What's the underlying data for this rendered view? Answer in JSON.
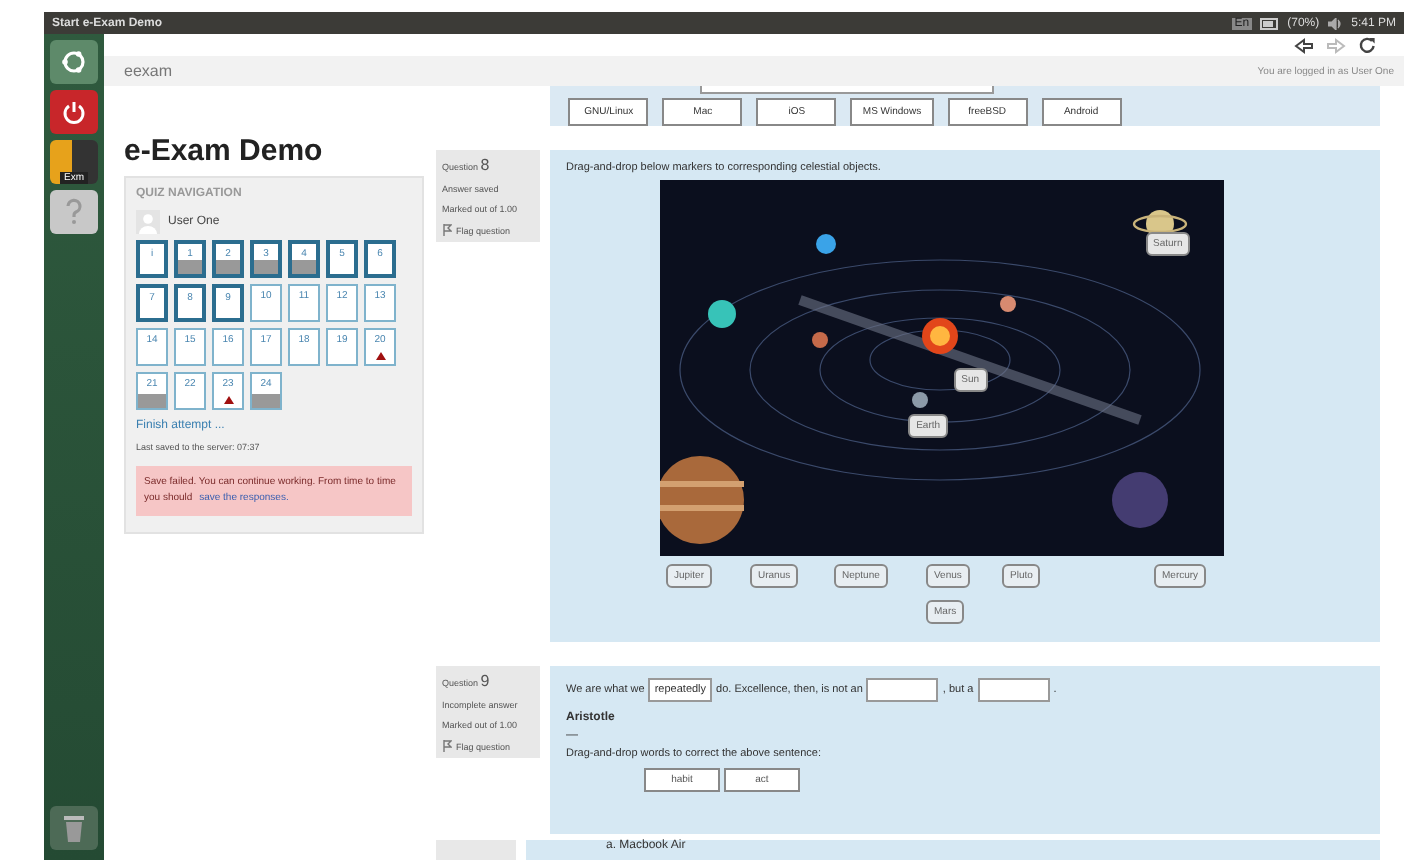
{
  "top_panel": {
    "title": "Start e-Exam Demo",
    "keyboard": "En",
    "battery": "(70%)",
    "time": "5:41 PM"
  },
  "launcher": {
    "exam_label": "Exm"
  },
  "header": {
    "site": "eexam",
    "login": "You are logged in as User One"
  },
  "page_title": "e-Exam Demo",
  "previous_question": {
    "options": [
      "GNU/Linux",
      "Mac",
      "iOS",
      "MS Windows",
      "freeBSD",
      "Android"
    ]
  },
  "quiz_navigation": {
    "heading": "QUIZ NAVIGATION",
    "user": "User One",
    "buttons": [
      {
        "label": "i",
        "current": true,
        "answered": false,
        "flagged": false
      },
      {
        "label": "1",
        "current": true,
        "answered": true,
        "flagged": false
      },
      {
        "label": "2",
        "current": true,
        "answered": true,
        "flagged": false
      },
      {
        "label": "3",
        "current": true,
        "answered": true,
        "flagged": false
      },
      {
        "label": "4",
        "current": true,
        "answered": true,
        "flagged": false
      },
      {
        "label": "5",
        "current": true,
        "answered": false,
        "flagged": false
      },
      {
        "label": "6",
        "current": true,
        "answered": false,
        "flagged": false
      },
      {
        "label": "7",
        "current": true,
        "answered": false,
        "flagged": false
      },
      {
        "label": "8",
        "current": true,
        "answered": false,
        "flagged": false
      },
      {
        "label": "9",
        "current": true,
        "answered": false,
        "flagged": false
      },
      {
        "label": "10",
        "current": false,
        "answered": false,
        "flagged": false
      },
      {
        "label": "11",
        "current": false,
        "answered": false,
        "flagged": false
      },
      {
        "label": "12",
        "current": false,
        "answered": false,
        "flagged": false
      },
      {
        "label": "13",
        "current": false,
        "answered": false,
        "flagged": false
      },
      {
        "label": "14",
        "current": false,
        "answered": false,
        "flagged": false
      },
      {
        "label": "15",
        "current": false,
        "answered": false,
        "flagged": false
      },
      {
        "label": "16",
        "current": false,
        "answered": false,
        "flagged": false
      },
      {
        "label": "17",
        "current": false,
        "answered": false,
        "flagged": false
      },
      {
        "label": "18",
        "current": false,
        "answered": false,
        "flagged": false
      },
      {
        "label": "19",
        "current": false,
        "answered": false,
        "flagged": false
      },
      {
        "label": "20",
        "current": false,
        "answered": false,
        "flagged": true
      },
      {
        "label": "21",
        "current": false,
        "answered": true,
        "flagged": false
      },
      {
        "label": "22",
        "current": false,
        "answered": false,
        "flagged": false
      },
      {
        "label": "23",
        "current": false,
        "answered": false,
        "flagged": true
      },
      {
        "label": "24",
        "current": false,
        "answered": true,
        "flagged": false
      }
    ],
    "finish": "Finish attempt ...",
    "last_saved": "Last saved to the server: 07:37",
    "alert": {
      "text": "Save failed. You can continue working. From time to time you should",
      "link": "save the responses."
    }
  },
  "questions": [
    {
      "kind": "drag-markers",
      "label": "Question",
      "number": "8",
      "status": "Answer saved",
      "marks": "Marked out of 1.00",
      "flag": "Flag question",
      "prompt": "Drag-and-drop below markers to corresponding celestial objects.",
      "placed_markers": [
        "Saturn",
        "Sun",
        "Earth"
      ],
      "markers": [
        "Jupiter",
        "Uranus",
        "Neptune",
        "Venus",
        "Pluto",
        "Mercury",
        "Mars"
      ]
    },
    {
      "kind": "drag-words",
      "label": "Question",
      "number": "9",
      "status": "Incomplete answer",
      "marks": "Marked out of 1.00",
      "flag": "Flag question",
      "sentence": [
        {
          "kind": "text",
          "text": "We are what we"
        },
        {
          "kind": "drop",
          "value": "repeatedly"
        },
        {
          "kind": "text",
          "text": "do. Excellence, then, is not an"
        },
        {
          "kind": "drop"
        },
        {
          "kind": "text",
          "text": ", but a"
        },
        {
          "kind": "drop"
        },
        {
          "kind": "text",
          "text": "."
        }
      ],
      "author": "Aristotle",
      "dash": "—",
      "instruction": "Drag-and-drop words to correct the above sentence:",
      "words": [
        "habit",
        "act"
      ]
    }
  ],
  "next_question": {
    "option": "a. Macbook Air"
  }
}
